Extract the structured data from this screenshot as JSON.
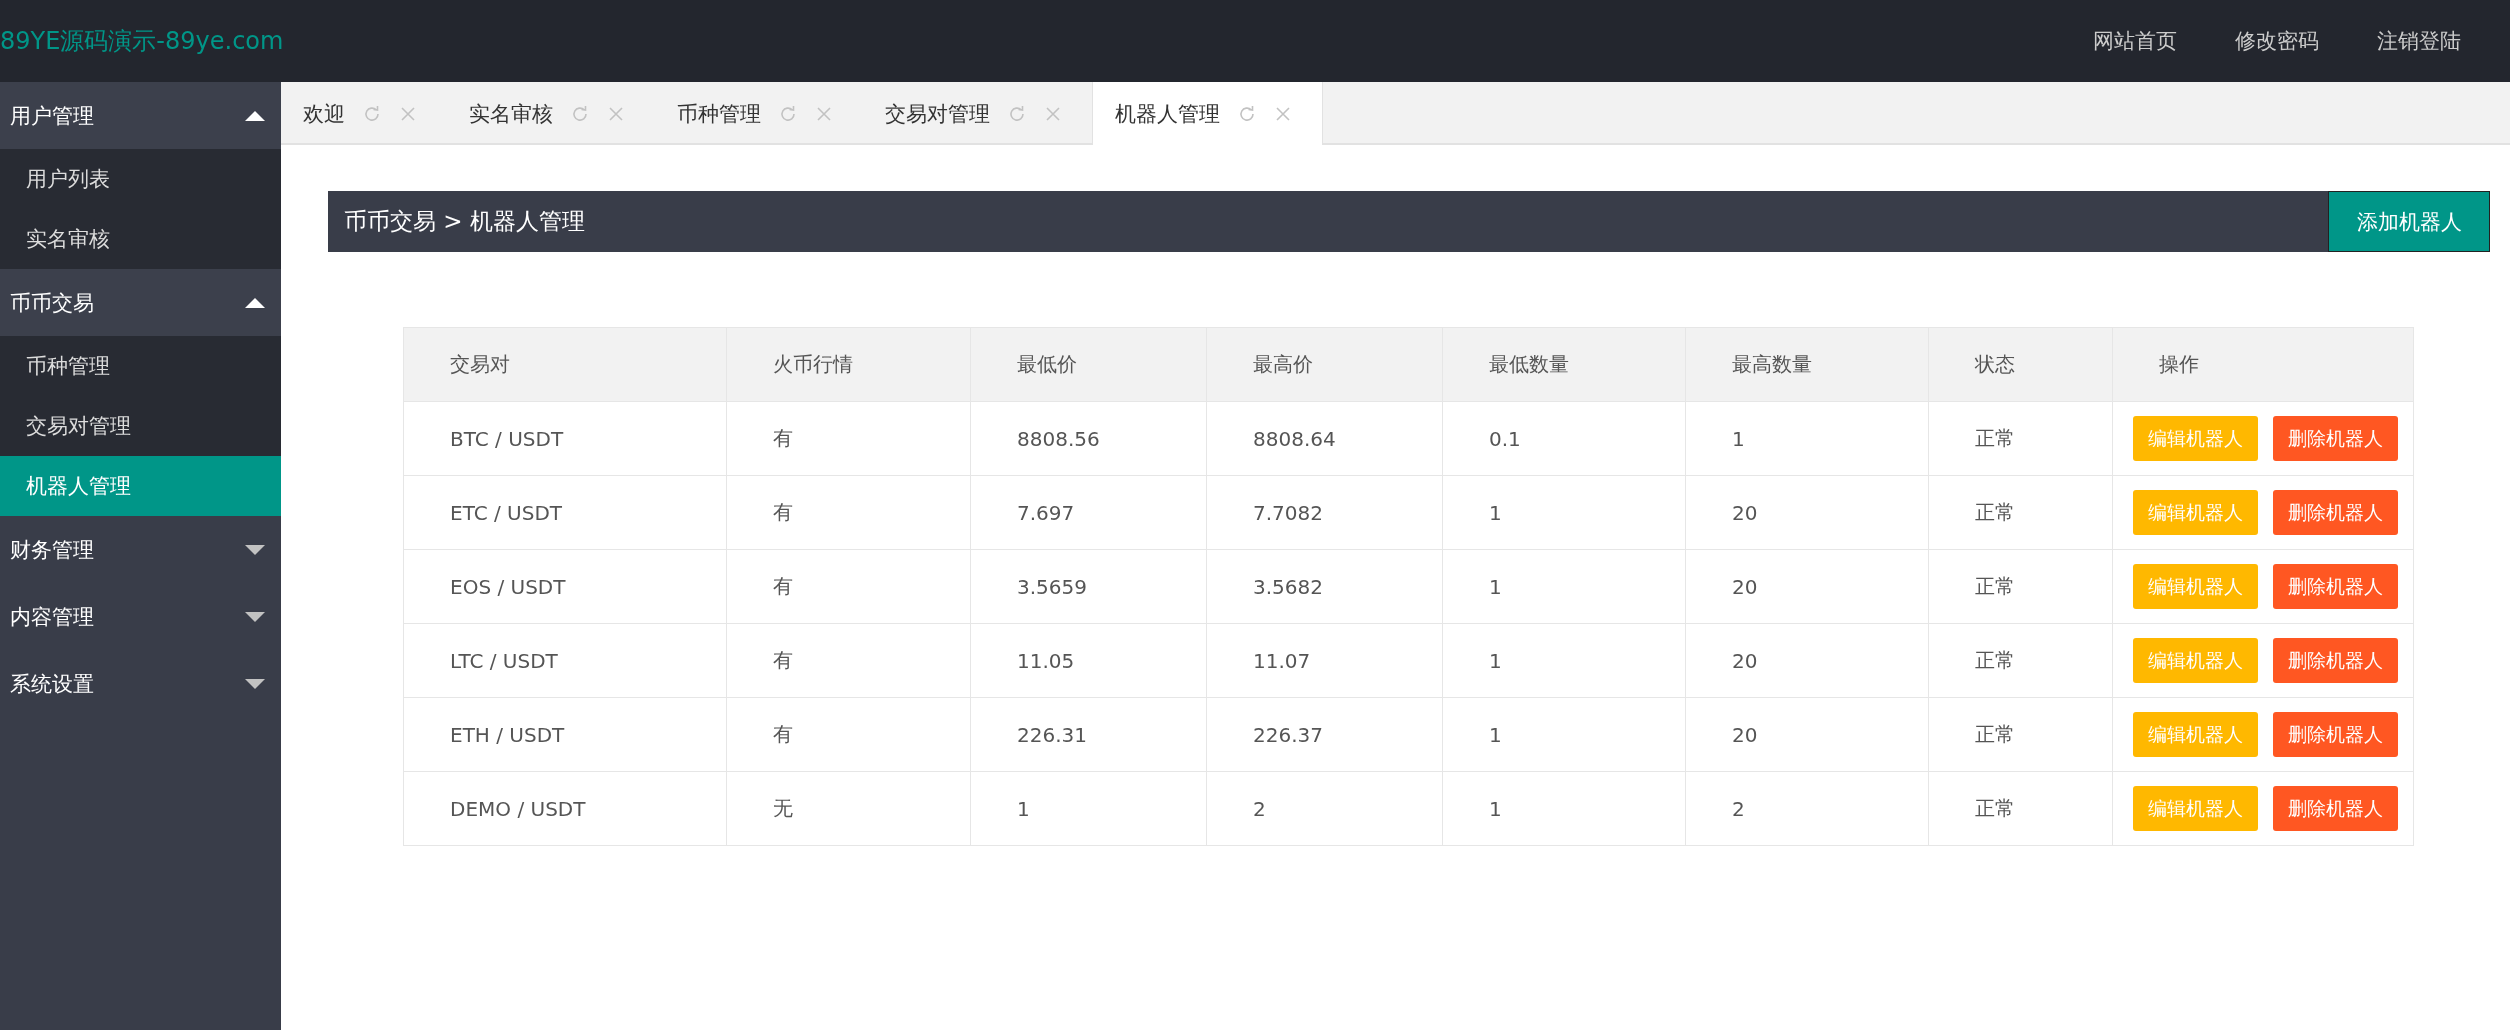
{
  "header": {
    "logo": "89YE源码演示-89ye.com",
    "links": [
      "网站首页",
      "修改密码",
      "注销登陆"
    ]
  },
  "sidebar": {
    "groups": [
      {
        "label": "用户管理",
        "expanded": true,
        "items": [
          {
            "label": "用户列表",
            "selected": false
          },
          {
            "label": "实名审核",
            "selected": false
          }
        ]
      },
      {
        "label": "币币交易",
        "expanded": true,
        "items": [
          {
            "label": "币种管理",
            "selected": false
          },
          {
            "label": "交易对管理",
            "selected": false
          },
          {
            "label": "机器人管理",
            "selected": true
          }
        ]
      },
      {
        "label": "财务管理",
        "expanded": false
      },
      {
        "label": "内容管理",
        "expanded": false
      },
      {
        "label": "系统设置",
        "expanded": false
      }
    ]
  },
  "tabs": [
    {
      "label": "欢迎",
      "selected": false
    },
    {
      "label": "实名审核",
      "selected": false
    },
    {
      "label": "币种管理",
      "selected": false
    },
    {
      "label": "交易对管理",
      "selected": false
    },
    {
      "label": "机器人管理",
      "selected": true
    }
  ],
  "breadcrumb": {
    "parts": [
      "币币交易",
      "机器人管理"
    ],
    "separator": ">",
    "button": "添加机器人"
  },
  "table": {
    "columns": [
      "交易对",
      "火币行情",
      "最低价",
      "最高价",
      "最低数量",
      "最高数量",
      "状态",
      "操作"
    ],
    "rows": [
      {
        "cells": [
          "BTC / USDT",
          "有",
          "8808.56",
          "8808.64",
          "0.1",
          "1",
          "正常"
        ],
        "actions": [
          "编辑机器人",
          "删除机器人"
        ]
      },
      {
        "cells": [
          "ETC / USDT",
          "有",
          "7.697",
          "7.7082",
          "1",
          "20",
          "正常"
        ],
        "actions": [
          "编辑机器人",
          "删除机器人"
        ]
      },
      {
        "cells": [
          "EOS / USDT",
          "有",
          "3.5659",
          "3.5682",
          "1",
          "20",
          "正常"
        ],
        "actions": [
          "编辑机器人",
          "删除机器人"
        ]
      },
      {
        "cells": [
          "LTC / USDT",
          "有",
          "11.05",
          "11.07",
          "1",
          "20",
          "正常"
        ],
        "actions": [
          "编辑机器人",
          "删除机器人"
        ]
      },
      {
        "cells": [
          "ETH / USDT",
          "有",
          "226.31",
          "226.37",
          "1",
          "20",
          "正常"
        ],
        "actions": [
          "编辑机器人",
          "删除机器人"
        ]
      },
      {
        "cells": [
          "DEMO / USDT",
          "无",
          "1",
          "2",
          "1",
          "2",
          "正常"
        ],
        "actions": [
          "编辑机器人",
          "删除机器人"
        ]
      }
    ]
  }
}
